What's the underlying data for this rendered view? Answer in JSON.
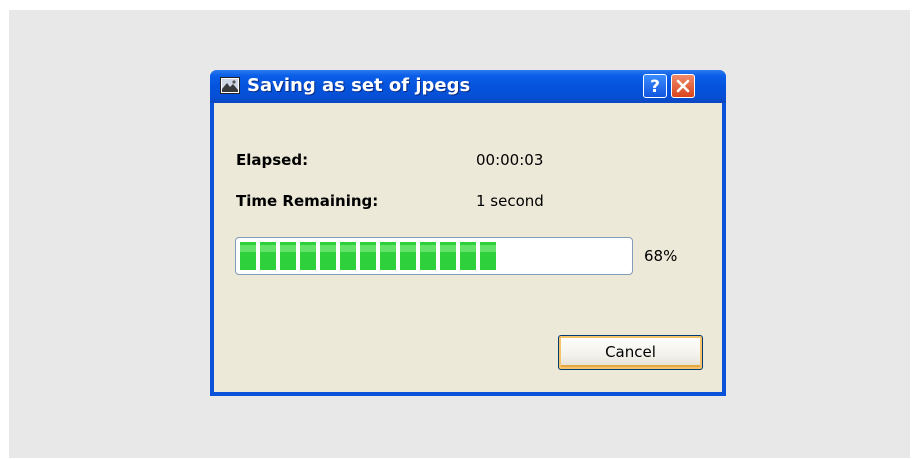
{
  "dialog": {
    "title": "Saving as set of jpegs",
    "help_button": "?",
    "close_button": "×",
    "elapsed_label": "Elapsed:",
    "elapsed_value": "00:00:03",
    "remaining_label": "Time Remaining:",
    "remaining_value": "1 second",
    "progress_percent": 68,
    "progress_text": "68%",
    "cancel_label": "Cancel"
  },
  "colors": {
    "titlebar": "#0553dd",
    "client_bg": "#ece9d8",
    "progress_green": "#2ed13b",
    "close_red": "#d9441a",
    "backdrop": "#e8e8e8"
  },
  "icons": {
    "app": "image-export-icon",
    "help": "question-mark-icon",
    "close": "close-x-icon"
  }
}
